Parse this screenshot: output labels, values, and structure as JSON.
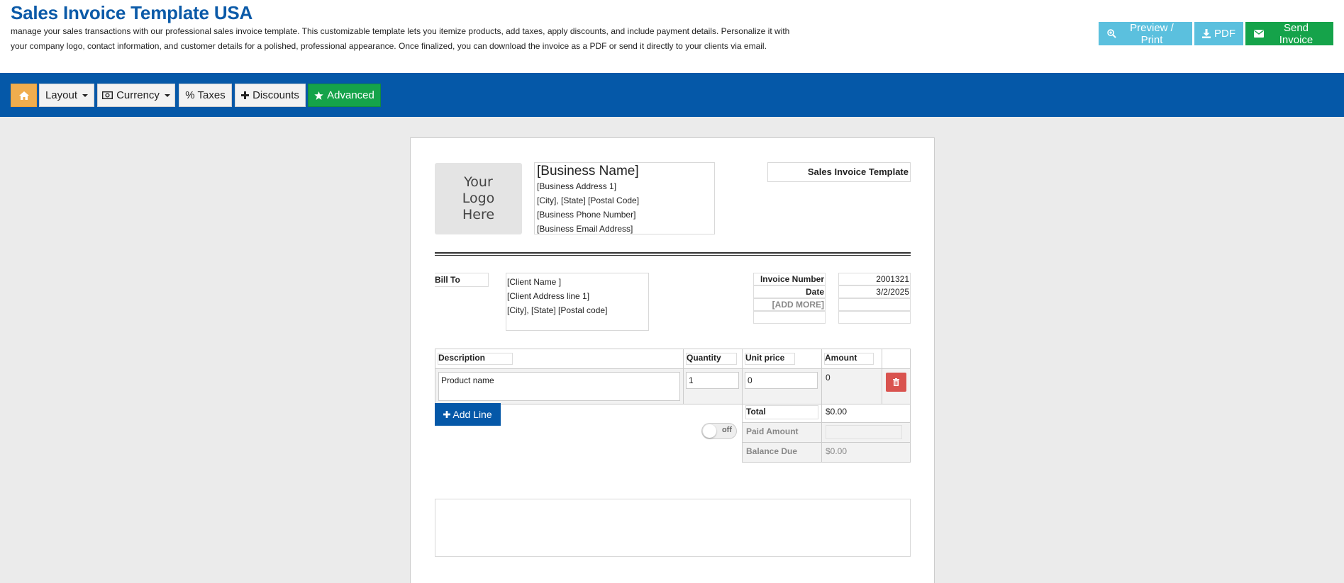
{
  "header": {
    "title": "Sales Invoice Template USA",
    "description": "manage your sales transactions with our professional sales invoice template. This customizable template lets you itemize products, add taxes, apply discounts, and include payment details. Personalize it with your company logo, contact information, and customer details for a polished, professional appearance. Once finalized, you can download the invoice as a PDF or send it directly to your clients via email.",
    "buttons": {
      "preview": "Preview / Print",
      "pdf": "PDF",
      "send": "Send Invoice"
    }
  },
  "toolbar": {
    "layout": "Layout",
    "currency": "Currency",
    "taxes": "% Taxes",
    "discounts": "Discounts",
    "advanced": "Advanced"
  },
  "invoice": {
    "logo_placeholder": "Your Logo Here",
    "business": {
      "name": "[Business Name]",
      "address1": "[Business Address 1]",
      "city_state": "[City], [State] [Postal Code]",
      "phone": "[Business Phone Number]",
      "email": "[Business Email Address]"
    },
    "doc_title": "Sales Invoice Template",
    "bill_to_label": "Bill To",
    "client": {
      "name": "[Client Name ]",
      "address1": "[Client Address line 1]",
      "city_state": "[City], [State] [Postal code]"
    },
    "meta": {
      "invoice_number_label": "Invoice Number",
      "invoice_number": "2001321",
      "date_label": "Date",
      "date": "3/2/2025",
      "add_more": "[ADD MORE]"
    },
    "columns": {
      "description": "Description",
      "quantity": "Quantity",
      "unit_price": "Unit price",
      "amount": "Amount"
    },
    "line_items": [
      {
        "description": "Product name",
        "quantity": "1",
        "unit_price": "0",
        "amount": "0"
      }
    ],
    "add_line": "Add Line",
    "toggle": "off",
    "totals": {
      "total_label": "Total",
      "total": "$0.00",
      "paid_label": "Paid Amount",
      "paid": "",
      "balance_label": "Balance Due",
      "balance": "$0.00"
    }
  },
  "colors": {
    "brand_blue": "#0558a8",
    "info": "#5bc0de",
    "success": "#15a34a",
    "warning": "#f0ad4e",
    "danger": "#d9534f"
  }
}
